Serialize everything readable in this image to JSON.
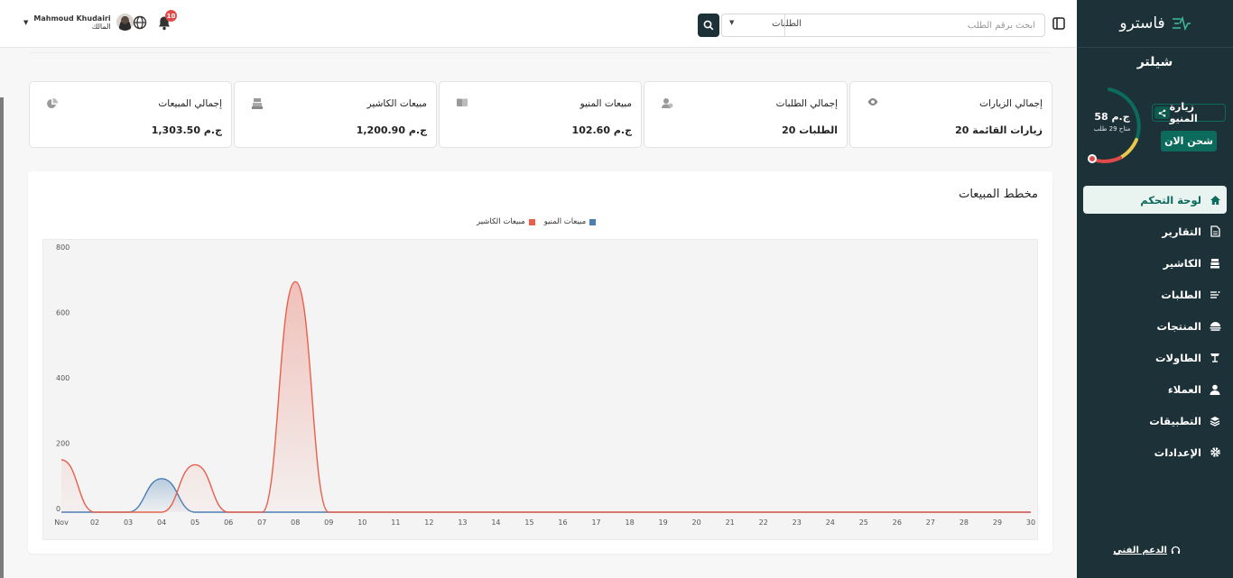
{
  "header": {
    "search_placeholder": "ابحث برقم الطلب",
    "search_category": "الطلبات",
    "notifications_count": "10",
    "user_name": "Mahmoud Khudairi",
    "user_role": "المالك"
  },
  "sidebar": {
    "brand": "فاسترو",
    "store_name": "شيلتر",
    "wallet_amount": "58 ج.م",
    "wallet_available": "متاح 29 طلب",
    "visit_menu": "زيارة المنيو",
    "charge_now": "شحن الان",
    "items": [
      {
        "label": "لوحة التحكم",
        "icon": "home-icon"
      },
      {
        "label": "التقارير",
        "icon": "report-icon"
      },
      {
        "label": "الكاشير",
        "icon": "cashier-icon"
      },
      {
        "label": "الطلبات",
        "icon": "orders-icon"
      },
      {
        "label": "المنتجات",
        "icon": "products-icon"
      },
      {
        "label": "الطاولات",
        "icon": "tables-icon"
      },
      {
        "label": "العملاء",
        "icon": "customers-icon"
      },
      {
        "label": "التطبيقات",
        "icon": "apps-icon"
      },
      {
        "label": "الإعدادات",
        "icon": "settings-icon"
      }
    ],
    "support": "الدعم الفني"
  },
  "stats": [
    {
      "title": "إجمالي الزيارات",
      "value": "20 زيارات القائمة",
      "icon": "eye-icon"
    },
    {
      "title": "إجمالي الطلبات",
      "value": "20 الطلبات",
      "icon": "user-order-icon"
    },
    {
      "title": "مبيعات المنيو",
      "value": "102.60 ج.م",
      "icon": "menu-book-icon"
    },
    {
      "title": "مبيعات الكاشير",
      "value": "1,200.90 ج.م",
      "icon": "cash-register-icon"
    },
    {
      "title": "إجمالي المبيعات",
      "value": "1,303.50 ج.م",
      "icon": "pie-chart-icon"
    }
  ],
  "colors": {
    "sidebar_bg": "#1d3138",
    "accent": "#0c6b5c",
    "menu_series": "#4a7fb5",
    "cashier_series": "#e8604c"
  },
  "chart_data": {
    "type": "area",
    "title": "مخطط المبيعات",
    "x": [
      "Nov",
      "02",
      "03",
      "04",
      "05",
      "06",
      "07",
      "08",
      "09",
      "10",
      "11",
      "12",
      "13",
      "14",
      "15",
      "16",
      "17",
      "18",
      "19",
      "20",
      "21",
      "22",
      "23",
      "24",
      "25",
      "26",
      "27",
      "28",
      "29",
      "30"
    ],
    "ylim": [
      0,
      800
    ],
    "yticks": [
      0,
      200,
      400,
      600,
      800
    ],
    "grid": false,
    "legend": "top-center",
    "series": [
      {
        "name": "مبيعات المنيو",
        "color": "#4a7fb5",
        "values": [
          0,
          0,
          0,
          102.6,
          0,
          0,
          0,
          0,
          0,
          0,
          0,
          0,
          0,
          0,
          0,
          0,
          0,
          0,
          0,
          0,
          0,
          0,
          0,
          0,
          0,
          0,
          0,
          0,
          0,
          0
        ]
      },
      {
        "name": "مبيعات الكاشير",
        "color": "#e8604c",
        "values": [
          160,
          0,
          0,
          0,
          145,
          0,
          0,
          705,
          0,
          0,
          0,
          0,
          0,
          0,
          0,
          0,
          0,
          0,
          0,
          0,
          0,
          0,
          0,
          0,
          0,
          0,
          0,
          0,
          0,
          0
        ]
      }
    ]
  }
}
